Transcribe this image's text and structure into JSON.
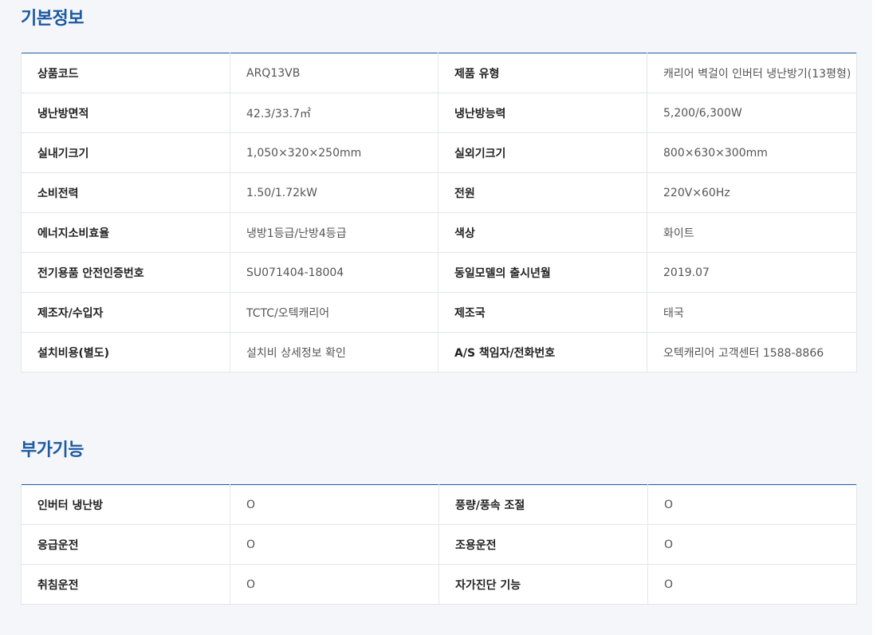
{
  "basic_info": {
    "title": "기본정보",
    "rows": [
      [
        {
          "label": "상품코드",
          "value": "ARQ13VB"
        },
        {
          "label": "제품 유형",
          "value": "캐리어 벽걸이 인버터 냉난방기(13평형)"
        }
      ],
      [
        {
          "label": "냉난방면적",
          "value": "42.3/33.7㎡"
        },
        {
          "label": "냉난방능력",
          "value": "5,200/6,300W"
        }
      ],
      [
        {
          "label": "실내기크기",
          "value": "1,050×320×250mm"
        },
        {
          "label": "실외기크기",
          "value": "800×630×300mm"
        }
      ],
      [
        {
          "label": "소비전력",
          "value": "1.50/1.72kW"
        },
        {
          "label": "전원",
          "value": "220V×60Hz"
        }
      ],
      [
        {
          "label": "에너지소비효율",
          "value": "냉방1등급/난방4등급"
        },
        {
          "label": "색상",
          "value": "화이트"
        }
      ],
      [
        {
          "label": "전기용품 안전인증번호",
          "value": "SU071404-18004"
        },
        {
          "label": "동일모델의 출시년월",
          "value": "2019.07"
        }
      ],
      [
        {
          "label": "제조자/수입자",
          "value": "TCTC/오텍캐리어"
        },
        {
          "label": "제조국",
          "value": "태국"
        }
      ],
      [
        {
          "label": "설치비용(별도)",
          "value": "설치비 상세정보 확인"
        },
        {
          "label": "A/S 책임자/전화번호",
          "value": "오텍캐리어 고객센터 1588-8866"
        }
      ]
    ]
  },
  "extra_features": {
    "title": "부가기능",
    "rows": [
      [
        {
          "label": "인버터 냉난방",
          "value": "O"
        },
        {
          "label": "풍량/풍속 조절",
          "value": "O"
        }
      ],
      [
        {
          "label": "응급운전",
          "value": "O"
        },
        {
          "label": "조용운전",
          "value": "O"
        }
      ],
      [
        {
          "label": "취침운전",
          "value": "O"
        },
        {
          "label": "자가진단 기능",
          "value": "O"
        }
      ]
    ]
  }
}
